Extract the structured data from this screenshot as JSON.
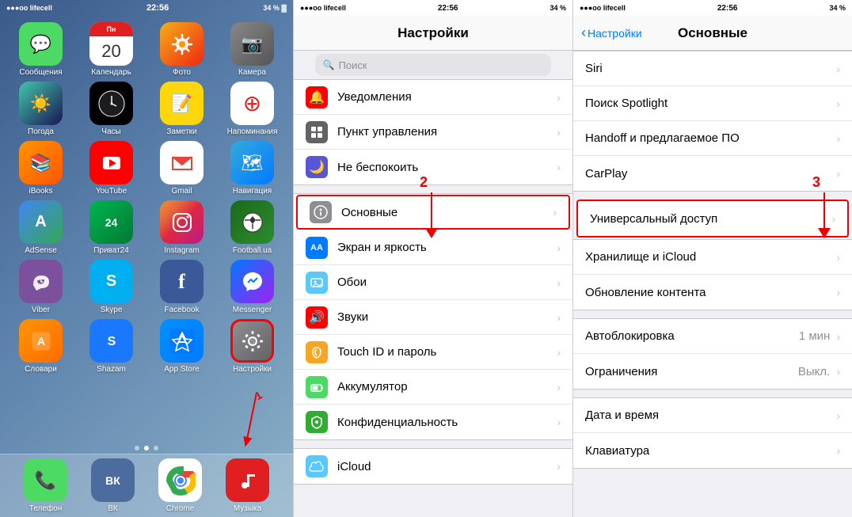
{
  "phone1": {
    "status": {
      "carrier": "●●●oo lifecell",
      "wifi": "▼",
      "time": "22:56",
      "battery": "34 % ▓"
    },
    "apps": [
      [
        {
          "label": "Сообщения",
          "icon": "messages",
          "emoji": "💬"
        },
        {
          "label": "Календарь",
          "icon": "calendar",
          "date": "20",
          "day": "Пн"
        },
        {
          "label": "Фото",
          "icon": "photos",
          "emoji": "🌅"
        },
        {
          "label": "Камера",
          "icon": "camera",
          "emoji": "📷"
        }
      ],
      [
        {
          "label": "Погода",
          "icon": "weather",
          "emoji": "☀️"
        },
        {
          "label": "Часы",
          "icon": "clock",
          "emoji": "🕐"
        },
        {
          "label": "Заметки",
          "icon": "notes",
          "emoji": "📝"
        },
        {
          "label": "Напоминания",
          "icon": "reminders",
          "emoji": "🔔"
        }
      ],
      [
        {
          "label": "iBooks",
          "icon": "ibooks",
          "emoji": "📚"
        },
        {
          "label": "YouTube",
          "icon": "youtube",
          "emoji": "▶"
        },
        {
          "label": "Gmail",
          "icon": "gmail",
          "emoji": "M"
        },
        {
          "label": "Навигация",
          "icon": "navigation",
          "emoji": "🗺"
        }
      ],
      [
        {
          "label": "AdSense",
          "icon": "adsense",
          "emoji": "A"
        },
        {
          "label": "Приват24",
          "icon": "privat",
          "emoji": "₴"
        },
        {
          "label": "Instagram",
          "icon": "instagram",
          "emoji": "📷"
        },
        {
          "label": "Football.ua",
          "icon": "football",
          "emoji": "⚽"
        }
      ],
      [
        {
          "label": "Viber",
          "icon": "viber",
          "emoji": "📞"
        },
        {
          "label": "Skype",
          "icon": "skype",
          "emoji": "S"
        },
        {
          "label": "Facebook",
          "icon": "facebook",
          "emoji": "f"
        },
        {
          "label": "Messenger",
          "icon": "messenger",
          "emoji": "💬"
        }
      ],
      [
        {
          "label": "Словари",
          "icon": "slovary",
          "emoji": "📖"
        },
        {
          "label": "Shazam",
          "icon": "shazam",
          "emoji": "♪"
        },
        {
          "label": "App Store",
          "icon": "appstore",
          "emoji": "A"
        },
        {
          "label": "Настройки",
          "icon": "settings",
          "emoji": "⚙️"
        }
      ]
    ],
    "dock": [
      {
        "label": "Телефон",
        "icon": "phone",
        "emoji": "📞"
      },
      {
        "label": "ВК",
        "icon": "vk",
        "emoji": "V"
      },
      {
        "label": "Chrome",
        "icon": "chrome",
        "emoji": ""
      },
      {
        "label": "Музыка",
        "icon": "music",
        "emoji": "▶"
      }
    ]
  },
  "phone2": {
    "status": {
      "carrier": "●●●oo lifecell",
      "time": "22:56",
      "battery": "34 %"
    },
    "title": "Настройки",
    "rows": [
      {
        "label": "Уведомления",
        "icon": "notifications",
        "color": "#e02020"
      },
      {
        "label": "Пункт управления",
        "icon": "control",
        "color": "#636366"
      },
      {
        "label": "Не беспокоить",
        "icon": "donotdisturb",
        "color": "#5856d6"
      },
      {
        "label": "Основные",
        "icon": "general",
        "color": "#8e8e93",
        "highlighted": true
      },
      {
        "label": "Экран и яркость",
        "icon": "display",
        "color": "#007aff"
      },
      {
        "label": "Обои",
        "icon": "wallpaper",
        "color": "#5ac8fa"
      },
      {
        "label": "Звуки",
        "icon": "sounds",
        "color": "#e02020"
      },
      {
        "label": "Touch ID и пароль",
        "icon": "touchid",
        "color": "#f5a623"
      },
      {
        "label": "Аккумулятор",
        "icon": "battery",
        "color": "#4cd964"
      },
      {
        "label": "Конфиденциальность",
        "icon": "privacy",
        "color": "#33aa33"
      },
      {
        "label": "iCloud",
        "icon": "icloud",
        "color": "#5ac8fa"
      }
    ],
    "annotation_number": "2",
    "arrow_label": "↓"
  },
  "phone3": {
    "status": {
      "carrier": "●●●oo lifecell",
      "time": "22:56",
      "battery": "34 %"
    },
    "nav_back": "Настройки",
    "title": "Основные",
    "rows": [
      {
        "label": "Siri",
        "value": ""
      },
      {
        "label": "Поиск Spotlight",
        "value": ""
      },
      {
        "label": "Handoff и предлагаемое ПО",
        "value": ""
      },
      {
        "label": "CarPlay",
        "value": ""
      },
      {
        "label": "Универсальный доступ",
        "value": "",
        "highlighted": true
      },
      {
        "label": "Хранилище и iCloud",
        "value": ""
      },
      {
        "label": "Обновление контента",
        "value": ""
      },
      {
        "label": "Автоблокировка",
        "value": "1 мин"
      },
      {
        "label": "Ограничения",
        "value": "Выкл."
      },
      {
        "label": "Дата и время",
        "value": ""
      },
      {
        "label": "Клавиатура",
        "value": ""
      }
    ],
    "annotation_number": "3"
  },
  "icons": {
    "chevron": "›",
    "back_arrow": "‹",
    "search": "🔍"
  }
}
